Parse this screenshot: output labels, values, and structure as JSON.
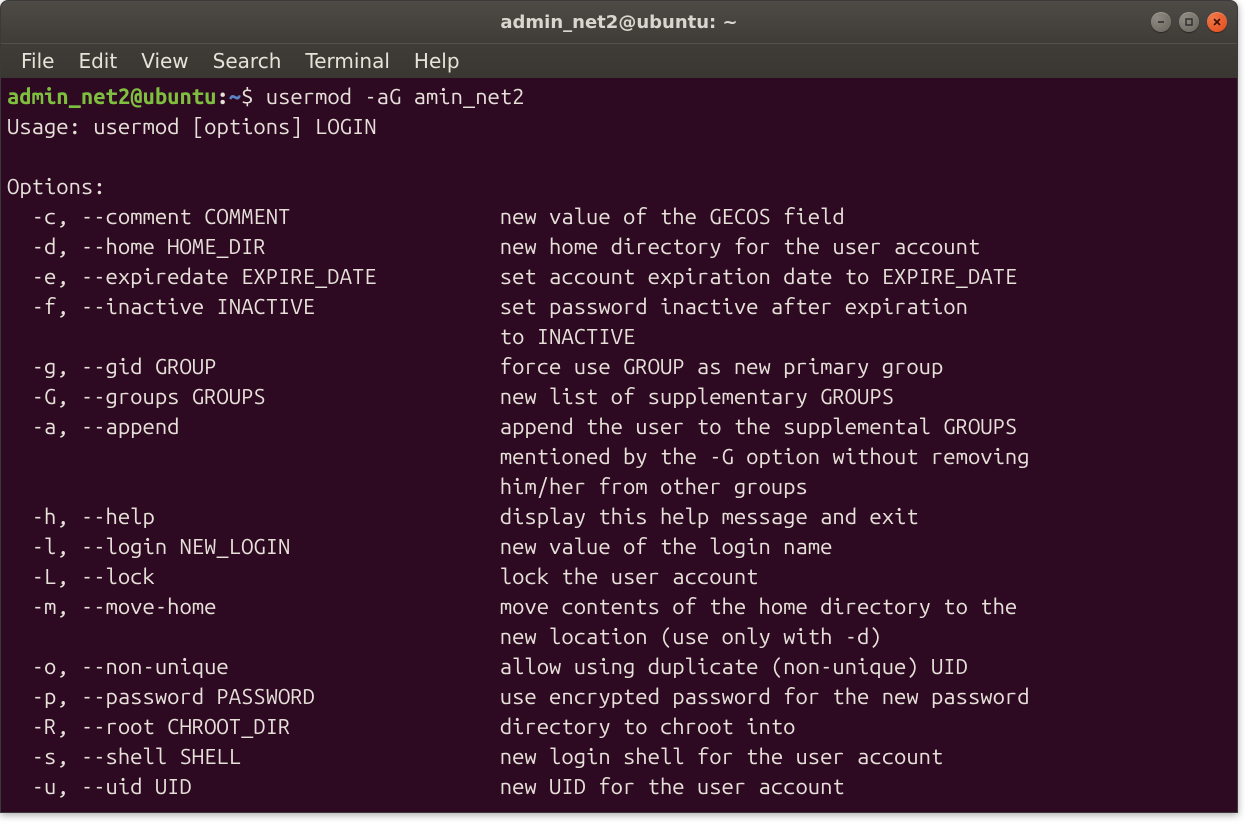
{
  "window": {
    "title": "admin_net2@ubuntu: ~"
  },
  "menu": {
    "items": [
      "File",
      "Edit",
      "View",
      "Search",
      "Terminal",
      "Help"
    ]
  },
  "prompt": {
    "userhost": "admin_net2@ubuntu",
    "sep": ":",
    "path": "~",
    "sigil": "$",
    "command": "usermod -aG amin_net2"
  },
  "output": {
    "usage": "Usage: usermod [options] LOGIN",
    "options_heading": "Options:",
    "options": [
      {
        "flags": "-c, --comment COMMENT",
        "desc": "new value of the GECOS field"
      },
      {
        "flags": "-d, --home HOME_DIR",
        "desc": "new home directory for the user account"
      },
      {
        "flags": "-e, --expiredate EXPIRE_DATE",
        "desc": "set account expiration date to EXPIRE_DATE"
      },
      {
        "flags": "-f, --inactive INACTIVE",
        "desc": "set password inactive after expiration\nto INACTIVE"
      },
      {
        "flags": "-g, --gid GROUP",
        "desc": "force use GROUP as new primary group"
      },
      {
        "flags": "-G, --groups GROUPS",
        "desc": "new list of supplementary GROUPS"
      },
      {
        "flags": "-a, --append",
        "desc": "append the user to the supplemental GROUPS\nmentioned by the -G option without removing\nhim/her from other groups"
      },
      {
        "flags": "-h, --help",
        "desc": "display this help message and exit"
      },
      {
        "flags": "-l, --login NEW_LOGIN",
        "desc": "new value of the login name"
      },
      {
        "flags": "-L, --lock",
        "desc": "lock the user account"
      },
      {
        "flags": "-m, --move-home",
        "desc": "move contents of the home directory to the\nnew location (use only with -d)"
      },
      {
        "flags": "-o, --non-unique",
        "desc": "allow using duplicate (non-unique) UID"
      },
      {
        "flags": "-p, --password PASSWORD",
        "desc": "use encrypted password for the new password"
      },
      {
        "flags": "-R, --root CHROOT_DIR",
        "desc": "directory to chroot into"
      },
      {
        "flags": "-s, --shell SHELL",
        "desc": "new login shell for the user account"
      },
      {
        "flags": "-u, --uid UID",
        "desc": "new UID for the user account"
      }
    ]
  }
}
